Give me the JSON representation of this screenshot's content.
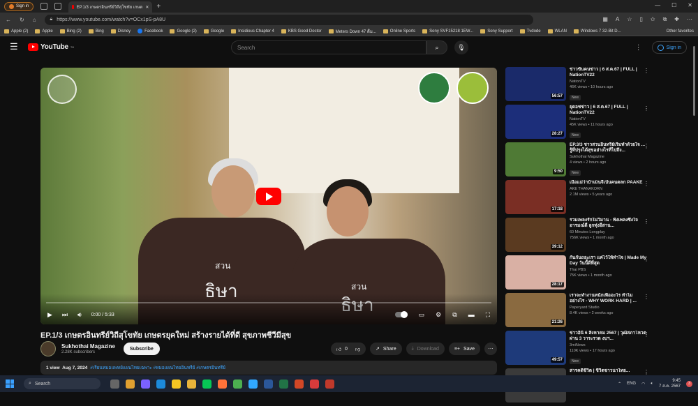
{
  "browser": {
    "signin": "Sign in",
    "tab_title": "EP.1/3 เกษตรอินทรีย์วิถีสุโขทัย เกษต",
    "url": "https://www.youtube.com/watch?v=OCx1pS-pA8U",
    "bookmarks": [
      "Apple (2)",
      "Apple",
      "Bing (2)",
      "Bing",
      "Disney",
      "Facebook",
      "Google (2)",
      "Google",
      "Insidious Chapter 4",
      "KBS Good Doctor",
      "Meters Down 47 ดื่ม...",
      "Online Sports",
      "Sony SVF15218 1EW...",
      "Sony Support",
      "Tvdode",
      "WLAN",
      "Windows 7 32-Bit D..."
    ],
    "other_favorites": "Other favorites"
  },
  "header": {
    "logo_text": "YouTube",
    "logo_sup": "TH",
    "search_placeholder": "Search",
    "signin": "Sign in"
  },
  "player": {
    "time": "0:00 / 5:33",
    "shirt_text": "สวน",
    "shirt_logo": "ธิษา"
  },
  "video": {
    "title": "EP.1/3 เกษตรอินทรีย์วิถีสุโขทัย เกษตรยุคใหม่ สร้างรายได้ที่ดี สุขภาพชีวีมีสุข",
    "channel": "Sukhothai Magazine",
    "subscribers": "2.28K subscribers",
    "subscribe": "Subscribe",
    "likes": "0",
    "share": "Share",
    "download": "Download",
    "save": "Save",
    "views": "1 view",
    "date": "Aug 7, 2024",
    "tags": "#เรียนหมอแพทย์แผนไทยเฉพาะ #หมอแผนไทยอินทรีย์ #เกษตรอินทรีย์"
  },
  "recommendations": [
    {
      "title": "ข่าวข้นคนข่าว | 6 ส.ค.67 | FULL | NationTV22",
      "channel": "NationTV",
      "meta": "46K views • 10 hours ago",
      "badge": "New",
      "duration": "56:57",
      "color": "#1a2a6a"
    },
    {
      "title": "ยุดอชข่าว | 6 ส.ค.67 | FULL | NationTV22",
      "channel": "NationTV",
      "meta": "45K views • 11 hours ago",
      "badge": "New",
      "duration": "28:27",
      "color": "#1c2e7a"
    },
    {
      "title": "EP.3/3 ชาวสวนอินทรีย์เริ่มทำด้วยใจ ... รู้ที่ปรุงได้สุขอย่างไรที่ไปถึง...",
      "channel": "Sukhothai Magazine",
      "meta": "4 views • 2 hours ago",
      "badge": "New",
      "duration": "9:50",
      "color": "#4f7a35"
    },
    {
      "title": "เมื่อแม่ว่าบ้าเม็นจีเป็นคนตลก PAAKE",
      "channel": "AKE THANAKORN",
      "meta": "2.1M views • 5 years ago",
      "badge": "",
      "duration": "17:18",
      "color": "#7a2e24"
    },
    {
      "title": "รวมเพลงรักในวิมาน - ฟังเพลงซึ้งใจ อารมณ์ดี ลูกทุ่งอีสาน...",
      "channel": "60 Minutes Longplay",
      "meta": "756K views • 1 month ago",
      "badge": "",
      "duration": "39:12",
      "color": "#5a3a20"
    },
    {
      "title": "กันกันถอะเรา แค่ไว้ให้ทำใจ | Made My Day วันนี้ดีที่สุด",
      "channel": "Thai PBS",
      "meta": "75K views • 1 month ago",
      "badge": "",
      "duration": "28:17",
      "color": "#d9b0a4"
    },
    {
      "title": "เราจะทำงานหนักเพื่ออะไร ทำไมอย่างไร - WHY WORK HARD | ...",
      "channel": "Paperyard Studio",
      "meta": "8.4K views • 2 weeks ago",
      "badge": "",
      "duration": "21:26",
      "color": "#8a6a40"
    },
    {
      "title": "ข่าวอินี่ 6 สิงหาคม 2567 | วุฒิสภาโหวตผ่าน 3 วาระรวด งบฯ...",
      "channel": "3miNews",
      "meta": "110K views • 17 hours ago",
      "badge": "New",
      "duration": "49:57",
      "color": "#1e3a7a"
    },
    {
      "title": "สารคดีชีวิต | ชีวิตชาวนาไทย...",
      "channel": "",
      "meta": "",
      "badge": "",
      "duration": "",
      "color": "#3a3a3a"
    }
  ],
  "taskbar": {
    "search": "Search",
    "lang": "ENG",
    "time": "9:45",
    "date": "7 ส.ค. 2567",
    "notif_count": "3"
  }
}
